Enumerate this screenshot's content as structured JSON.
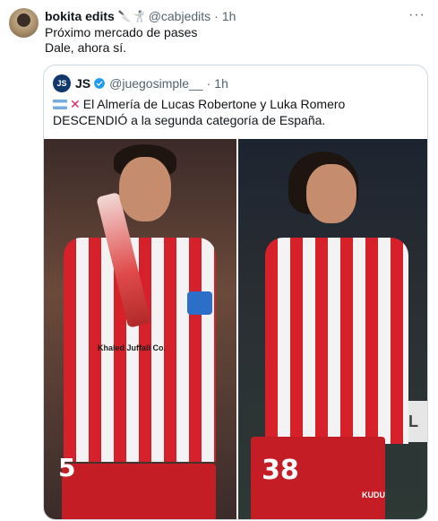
{
  "tweet": {
    "author_name": "bokita edits",
    "author_emoji": "🔪🤺",
    "handle": "@cabjedits",
    "dot": "·",
    "time": "1h",
    "more_icon": "more-horizontal-icon",
    "lines": [
      "Próximo mercado de pases",
      "Dale, ahora sí."
    ]
  },
  "quote": {
    "avatar_text": "JS",
    "name": "JS",
    "handle": "@juegosimple__",
    "dot": "·",
    "time": "1h",
    "text": "El Almería de Lucas Robertone y Luka Romero DESCENDIÓ a la segunda categoría de España.",
    "verified_color": "#1d9bf0",
    "cross_color": "#e0245e"
  },
  "media": {
    "left_player_number": "5",
    "right_player_number": "38",
    "left_sponsor": "Khaled Juffali Co.",
    "right_sponsor": "KUDU",
    "board_text": "DE L"
  },
  "colors": {
    "text_primary": "#0f1419",
    "text_secondary": "#536471",
    "border": "#cfd9de",
    "kit_red": "#d6202a"
  }
}
